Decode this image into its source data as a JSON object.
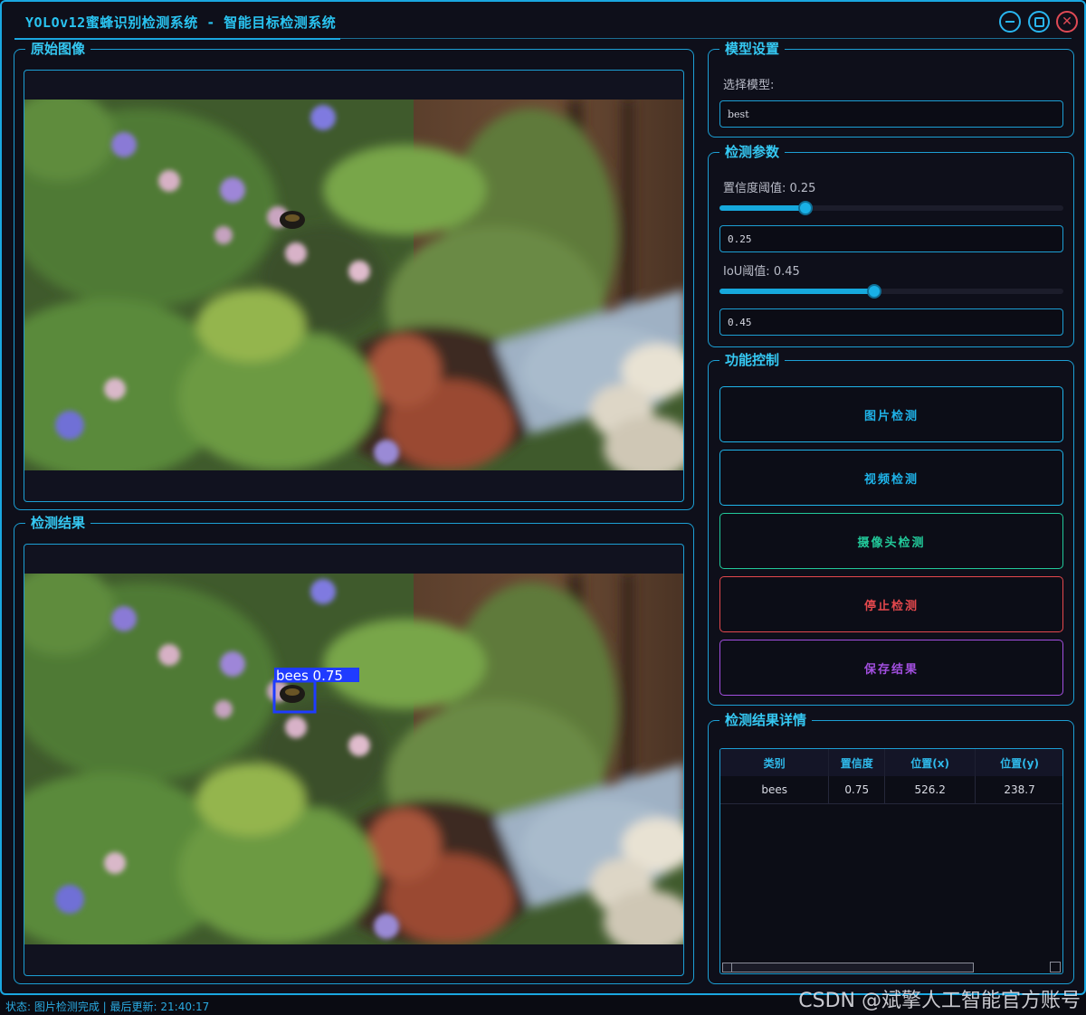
{
  "window": {
    "title": "YOLOv12蜜蜂识别检测系统 - 智能目标检测系统"
  },
  "original_panel": {
    "title": "原始图像"
  },
  "result_panel": {
    "title": "检测结果",
    "detection_label": "bees 0.75"
  },
  "model_settings": {
    "title": "模型设置",
    "select_label": "选择模型:",
    "selected_model": "best"
  },
  "detection_params": {
    "title": "检测参数",
    "confidence_label": "置信度阈值: 0.25",
    "confidence_value": "0.25",
    "confidence_level": 0.25,
    "iou_label": "IoU阈值: 0.45",
    "iou_value": "0.45",
    "iou_level": 0.45
  },
  "function_controls": {
    "title": "功能控制",
    "buttons": [
      {
        "label": "图片检测",
        "color": "#1fb4ea"
      },
      {
        "label": "视频检测",
        "color": "#1fb4ea"
      },
      {
        "label": "摄像头检测",
        "color": "#22c99a"
      },
      {
        "label": "停止检测",
        "color": "#e5484d"
      },
      {
        "label": "保存结果",
        "color": "#a34fe0"
      }
    ]
  },
  "results_detail": {
    "title": "检测结果详情",
    "columns": [
      "类别",
      "置信度",
      "位置(x)",
      "位置(y)"
    ],
    "rows": [
      [
        "bees",
        "0.75",
        "526.2",
        "238.7"
      ]
    ]
  },
  "statusbar": {
    "text": "状态: 图片检测完成 | 最后更新: 21:40:17",
    "watermark": "CSDN @斌擎人工智能官方账号"
  },
  "colors": {
    "accent": "#1aa7e0",
    "background": "#0e0f1a",
    "detection_box": "#1f3bff"
  }
}
